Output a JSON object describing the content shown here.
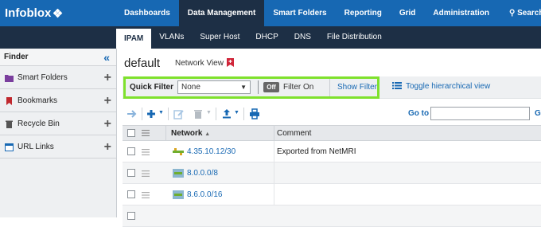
{
  "app": {
    "logo_text": "Infoblox"
  },
  "topnav": {
    "items": [
      "Dashboards",
      "Data Management",
      "Smart Folders",
      "Reporting",
      "Grid",
      "Administration"
    ],
    "active": "Data Management",
    "search_label": "Search"
  },
  "subnav": {
    "items": [
      "IPAM",
      "VLANs",
      "Super Host",
      "DHCP",
      "DNS",
      "File Distribution"
    ],
    "active": "IPAM"
  },
  "finder": {
    "title": "Finder",
    "items": [
      {
        "label": "Smart Folders",
        "icon": "smart-folder-icon"
      },
      {
        "label": "Bookmarks",
        "icon": "bookmark-icon"
      },
      {
        "label": "Recycle Bin",
        "icon": "recycle-bin-icon"
      },
      {
        "label": "URL Links",
        "icon": "url-links-icon"
      }
    ]
  },
  "page": {
    "title": "default",
    "subtitle": "Network View"
  },
  "filter": {
    "quick_filter_label": "Quick Filter",
    "quick_filter_value": "None",
    "toggle_label": "Off",
    "filter_on_label": "Filter On",
    "show_filter_label": "Show Filter",
    "toggle_view_label": "Toggle hierarchical view",
    "highlight_color": "#7fe12d"
  },
  "toolbar": {
    "goto_label": "Go to",
    "goto_value": "",
    "go_label": "Go"
  },
  "grid": {
    "columns": [
      "Network",
      "Comment"
    ],
    "rows": [
      {
        "network": "4.35.10.12/30",
        "comment": "Exported from NetMRI",
        "icon": "network-icon"
      },
      {
        "network": "8.0.0.0/8",
        "comment": "",
        "icon": "network-container-icon"
      },
      {
        "network": "8.6.0.0/16",
        "comment": "",
        "icon": "network-container-icon"
      }
    ]
  },
  "colors": {
    "brand_blue": "#1768b3",
    "nav_dark": "#1d2f45",
    "link_blue": "#1768b3"
  }
}
